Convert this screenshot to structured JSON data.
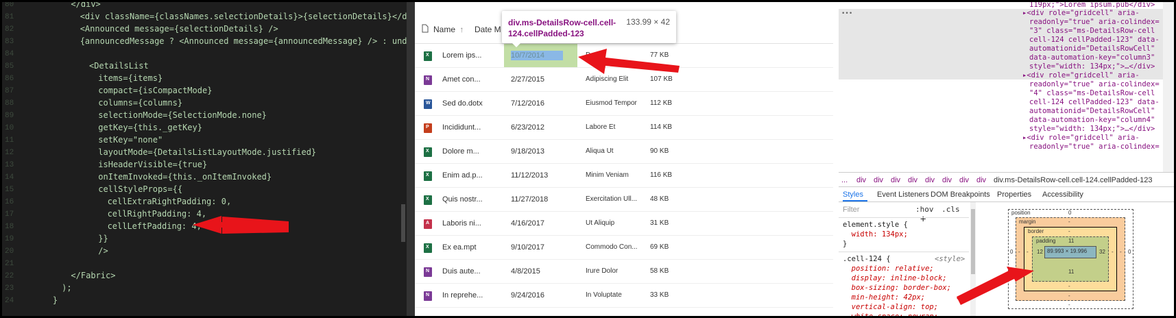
{
  "editor": {
    "line_numbers": [
      "80",
      "81",
      "82",
      "83",
      "84",
      "85",
      "86",
      "87",
      "88",
      "89",
      "10",
      "11",
      "12",
      "13",
      "14",
      "15",
      "16",
      "17",
      "18",
      "19",
      "20",
      "21",
      "22",
      "23",
      "24"
    ],
    "lines": [
      {
        "indent": 5,
        "text": "</div>"
      },
      {
        "indent": 6,
        "text": "<div className={classNames.selectionDetails}>{selectionDetails}</div>"
      },
      {
        "indent": 6,
        "text": "<Announced message={selectionDetails} />"
      },
      {
        "indent": 6,
        "text": "{announcedMessage ? <Announced message={announcedMessage} /> : undefined}"
      },
      {
        "indent": 0,
        "text": ""
      },
      {
        "indent": 7,
        "text": "<DetailsList"
      },
      {
        "indent": 8,
        "text": "items={items}"
      },
      {
        "indent": 8,
        "text": "compact={isCompactMode}"
      },
      {
        "indent": 8,
        "text": "columns={columns}"
      },
      {
        "indent": 8,
        "text": "selectionMode={SelectionMode.none}"
      },
      {
        "indent": 8,
        "text": "getKey={this._getKey}"
      },
      {
        "indent": 8,
        "text": "setKey=\"none\""
      },
      {
        "indent": 8,
        "text": "layoutMode={DetailsListLayoutMode.justified}"
      },
      {
        "indent": 8,
        "text": "isHeaderVisible={true}"
      },
      {
        "indent": 8,
        "text": "onItemInvoked={this._onItemInvoked}"
      },
      {
        "indent": 8,
        "text": "cellStyleProps={{"
      },
      {
        "indent": 9,
        "text": "cellExtraRightPadding: 0,"
      },
      {
        "indent": 9,
        "text": "cellRightPadding: 4,"
      },
      {
        "indent": 9,
        "text": "cellLeftPadding: 4,"
      },
      {
        "indent": 8,
        "text": "}}"
      },
      {
        "indent": 8,
        "text": "/>"
      },
      {
        "indent": 0,
        "text": ""
      },
      {
        "indent": 5,
        "text": "</Fabric>"
      },
      {
        "indent": 4,
        "text": ");"
      },
      {
        "indent": 3,
        "text": "}"
      }
    ]
  },
  "list": {
    "columns": {
      "name": "Name",
      "name_sort": "↑",
      "date": "Date M"
    },
    "tooltip": {
      "title": "div.ms-DetailsRow-cell.cell-124.cellPadded-123",
      "size": "133.99 × 42"
    },
    "rows": [
      {
        "name": "Lorem ips...",
        "date": "10/7/2014",
        "author": "D",
        "size": "77 KB",
        "icon": "excel-icon",
        "color": "#1d7044",
        "letter": "X"
      },
      {
        "name": "Amet con...",
        "date": "2/27/2015",
        "author": "Adipiscing Elit",
        "size": "107 KB",
        "icon": "onenote-icon",
        "color": "#7b3a96",
        "letter": "N"
      },
      {
        "name": "Sed do.dotx",
        "date": "7/12/2016",
        "author": "Eiusmod Tempor",
        "size": "112 KB",
        "icon": "word-icon",
        "color": "#2b579a",
        "letter": "W"
      },
      {
        "name": "Incididunt...",
        "date": "6/23/2012",
        "author": "Labore Et",
        "size": "114 KB",
        "icon": "powerpoint-icon",
        "color": "#c43e1c",
        "letter": "P"
      },
      {
        "name": "Dolore m...",
        "date": "9/18/2013",
        "author": "Aliqua Ut",
        "size": "90 KB",
        "icon": "excel-icon",
        "color": "#1d7044",
        "letter": "X"
      },
      {
        "name": "Enim ad.p...",
        "date": "11/12/2013",
        "author": "Minim Veniam",
        "size": "116 KB",
        "icon": "excel-icon",
        "color": "#1d7044",
        "letter": "X"
      },
      {
        "name": "Quis nostr...",
        "date": "11/27/2018",
        "author": "Exercitation Ull...",
        "size": "48 KB",
        "icon": "excel-icon",
        "color": "#1d7044",
        "letter": "X"
      },
      {
        "name": "Laboris ni...",
        "date": "4/16/2017",
        "author": "Ut Aliquip",
        "size": "31 KB",
        "icon": "pdf-icon",
        "color": "#c4314b",
        "letter": "A"
      },
      {
        "name": "Ex ea.mpt",
        "date": "9/10/2017",
        "author": "Commodo Con...",
        "size": "69 KB",
        "icon": "excel-icon",
        "color": "#1d7044",
        "letter": "X"
      },
      {
        "name": "Duis aute...",
        "date": "4/8/2015",
        "author": "Irure Dolor",
        "size": "58 KB",
        "icon": "onenote-icon",
        "color": "#7b3a96",
        "letter": "N"
      },
      {
        "name": "In reprehe...",
        "date": "9/24/2016",
        "author": "In Voluptate",
        "size": "33 KB",
        "icon": "onenote-icon",
        "color": "#7b3a96",
        "letter": "N"
      }
    ]
  },
  "devtools": {
    "ellipsis": "•••",
    "dom_top": "119px;\">Lorem ipsum.pub</div>",
    "dom_lines": [
      "▸<div role=\"gridcell\" aria-",
      "readonly=\"true\" aria-colindex=",
      "\"3\" class=\"ms-DetailsRow-cell",
      "cell-124 cellPadded-123\" data-",
      "automationid=\"DetailsRowCell\"",
      "data-automation-key=\"column3\"",
      "style=\"width: 134px;\">…</div>",
      "▸<div role=\"gridcell\" aria-",
      "readonly=\"true\" aria-colindex=",
      "\"4\" class=\"ms-DetailsRow-cell",
      "cell-124 cellPadded-123\" data-",
      "automationid=\"DetailsRowCell\"",
      "data-automation-key=\"column4\"",
      "style=\"width: 134px;\">…</div>",
      "▸<div role=\"gridcell\" aria-",
      "readonly=\"true\" aria-colindex="
    ],
    "breadcrumbs": [
      "...",
      "div",
      "div",
      "div",
      "div",
      "div",
      "div",
      "div",
      "div",
      "div.ms-DetailsRow-cell.cell-124.cellPadded-123"
    ],
    "tabs": [
      "Styles",
      "Event Listeners",
      "DOM Breakpoints",
      "Properties",
      "Accessibility"
    ],
    "filter_placeholder": "Filter",
    "hov": ":hov",
    "cls": ".cls",
    "plus": "+",
    "style_lines": [
      {
        "t": "element.style {",
        "k": "sel"
      },
      {
        "t": "  width: 134px;",
        "k": "prop"
      },
      {
        "t": "}",
        "k": "sel"
      },
      {
        "t": ".cell-124 {",
        "k": "sel",
        "src": "<style>"
      },
      {
        "t": "  position: relative;",
        "k": "prop"
      },
      {
        "t": "  display: inline-block;",
        "k": "prop"
      },
      {
        "t": "  box-sizing: border-box;",
        "k": "prop"
      },
      {
        "t": "  min-height: 42px;",
        "k": "prop"
      },
      {
        "t": "  vertical-align: top;",
        "k": "prop"
      },
      {
        "t": "  white-space: nowrap;",
        "k": "prop"
      }
    ],
    "box_model": {
      "position_label": "position",
      "position_value": "0",
      "margin_label": "margin",
      "margin_value": "-",
      "border_label": "border",
      "border_value": "-",
      "padding_label": "padding",
      "padding_top": "11",
      "padding_left": "12",
      "padding_right": "32",
      "padding_bottom": "11",
      "content": "89.993 × 19.996",
      "border_bottom": "-",
      "margin_bottom": "-",
      "position_bottom": "-",
      "left_outer": "0",
      "right_outer": "0",
      "left_dash1": "-",
      "left_dash2": "-",
      "right_dash1": "-",
      "right_dash2": "-"
    }
  },
  "colors": {
    "arrow": "#e8141a",
    "selection_green": "#c2dea5",
    "content_blue": "#8cb6c0",
    "padding_green": "#c3cf8a",
    "border_yellow": "#fddd9b",
    "margin_orange": "#f9cc9d"
  }
}
